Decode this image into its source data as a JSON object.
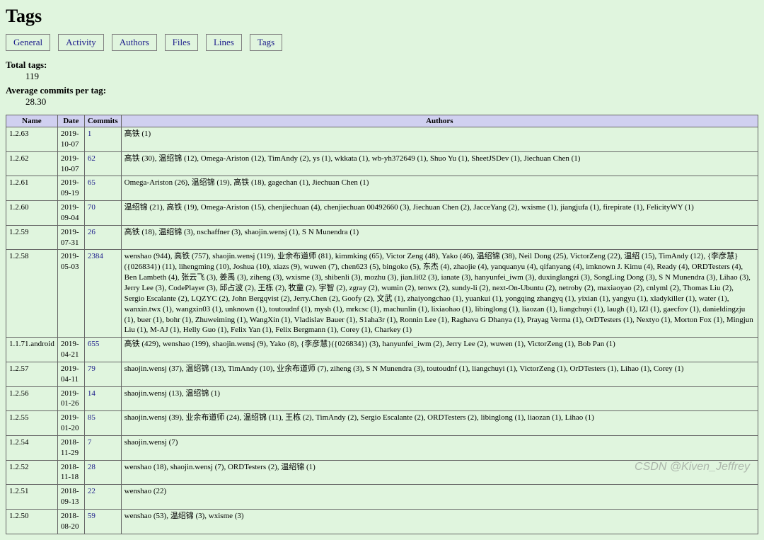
{
  "page_title": "Tags",
  "tabs": [
    "General",
    "Activity",
    "Authors",
    "Files",
    "Lines",
    "Tags"
  ],
  "stats": {
    "total_tags_label": "Total tags:",
    "total_tags_value": "119",
    "avg_commits_label": "Average commits per tag:",
    "avg_commits_value": "28.30"
  },
  "columns": [
    "Name",
    "Date",
    "Commits",
    "Authors"
  ],
  "rows": [
    {
      "name": "1.2.63",
      "date": "2019-10-07",
      "commits": "1",
      "authors": "高铁 (1)"
    },
    {
      "name": "1.2.62",
      "date": "2019-10-07",
      "commits": "62",
      "authors": "高铁 (30), 温绍锦 (12), Omega-Ariston (12), TimAndy (2), ys (1), wkkata (1), wb-yh372649 (1), Shuo Yu (1), SheetJSDev (1), Jiechuan Chen (1)"
    },
    {
      "name": "1.2.61",
      "date": "2019-09-19",
      "commits": "65",
      "authors": "Omega-Ariston (26), 温绍锦 (19), 高铁 (18), gagechan (1), Jiechuan Chen (1)"
    },
    {
      "name": "1.2.60",
      "date": "2019-09-04",
      "commits": "70",
      "authors": "温绍锦 (21), 高铁 (19), Omega-Ariston (15), chenjiechuan (4), chenjiechuan 00492660 (3), Jiechuan Chen (2), JacceYang (2), wxisme (1), jiangjufa (1), firepirate (1), FelicityWY (1)"
    },
    {
      "name": "1.2.59",
      "date": "2019-07-31",
      "commits": "26",
      "authors": "高铁 (18), 温绍锦 (3), nschaffner (3), shaojin.wensj (1), S N Munendra (1)"
    },
    {
      "name": "1.2.58",
      "date": "2019-05-03",
      "commits": "2384",
      "authors": "wenshao (944), 高铁 (757), shaojin.wensj (119), 业余布道师 (81), kimmking (65), Victor Zeng (48), Yako (46), 温绍锦 (38), Neil Dong (25), VictorZeng (22), 温绍 (15), TimAndy (12), {李彦慧}({026834}) (11), lihengming (10), Joshua (10), xiazs (9), wuwen (7), chen623 (5), bingoko (5), 东杰 (4), zhaojie (4), yanquanyu (4), qifanyang (4), imknown J. Kimu (4), Ready (4), ORDTesters (4), Ben Lambeth (4), 张云飞 (3), 姜禹 (3), ziheng (3), wxisme (3), shibenli (3), mozhu (3), jian.li02 (3), ianate (3), hanyunfei_iwm (3), duxinglangzi (3), SongLing Dong (3), S N Munendra (3), Lihao (3), Jerry Lee (3), CodePlayer (3), 邱占波 (2), 王栋 (2), 牧童 (2), 宇智 (2), zgray (2), wumin (2), tenwx (2), sundy-li (2), next-On-Ubuntu (2), netroby (2), maxiaoyao (2), cnlyml (2), Thomas Liu (2), Sergio Escalante (2), LQZYC (2), John Bergqvist (2), Jerry.Chen (2), Goofy (2), 文武 (1), zhaiyongchao (1), yuankui (1), yongqing zhangyq (1), yixian (1), yangyu (1), xladykiller (1), water (1), wanxin.twx (1), wangxin03 (1), unknown (1), toutoudnf (1), mysh (1), mrkcsc (1), machunlin (1), lixiaohao (1), libinglong (1), liaozan (1), liangchuyi (1), laugh (1), lZl (1), gaecfov (1), danieldingzju (1), buer (1), bohr (1), Zhuweiming (1), WangXin (1), Vladislav Bauer (1), S1aha3r (1), Ronnin Lee (1), Raghava G Dhanya (1), Prayag Verma (1), OrDTesters (1), Nextyo (1), Morton Fox (1), Mingjun Liu (1), M-AJ (1), Helly Guo (1), Felix Yan (1), Felix Bergmann (1), Corey (1), Charkey (1)"
    },
    {
      "name": "1.1.71.android",
      "date": "2019-04-21",
      "commits": "655",
      "authors": "高铁 (429), wenshao (199), shaojin.wensj (9), Yako (8), {李彦慧}({026834}) (3), hanyunfei_iwm (2), Jerry Lee (2), wuwen (1), VictorZeng (1), Bob Pan (1)"
    },
    {
      "name": "1.2.57",
      "date": "2019-04-11",
      "commits": "79",
      "authors": "shaojin.wensj (37), 温绍锦 (13), TimAndy (10), 业余布道师 (7), ziheng (3), S N Munendra (3), toutoudnf (1), liangchuyi (1), VictorZeng (1), OrDTesters (1), Lihao (1), Corey (1)"
    },
    {
      "name": "1.2.56",
      "date": "2019-01-26",
      "commits": "14",
      "authors": "shaojin.wensj (13), 温绍锦 (1)"
    },
    {
      "name": "1.2.55",
      "date": "2019-01-20",
      "commits": "85",
      "authors": "shaojin.wensj (39), 业余布道师 (24), 温绍锦 (11), 王栋 (2), TimAndy (2), Sergio Escalante (2), ORDTesters (2), libinglong (1), liaozan (1), Lihao (1)"
    },
    {
      "name": "1.2.54",
      "date": "2018-11-29",
      "commits": "7",
      "authors": "shaojin.wensj (7)"
    },
    {
      "name": "1.2.52",
      "date": "2018-11-18",
      "commits": "28",
      "authors": "wenshao (18), shaojin.wensj (7), ORDTesters (2), 温绍锦 (1)"
    },
    {
      "name": "1.2.51",
      "date": "2018-09-13",
      "commits": "22",
      "authors": "wenshao (22)"
    },
    {
      "name": "1.2.50",
      "date": "2018-08-20",
      "commits": "59",
      "authors": "wenshao (53), 温绍锦 (3), wxisme (3)"
    }
  ],
  "watermark": "CSDN @Kiven_Jeffrey"
}
